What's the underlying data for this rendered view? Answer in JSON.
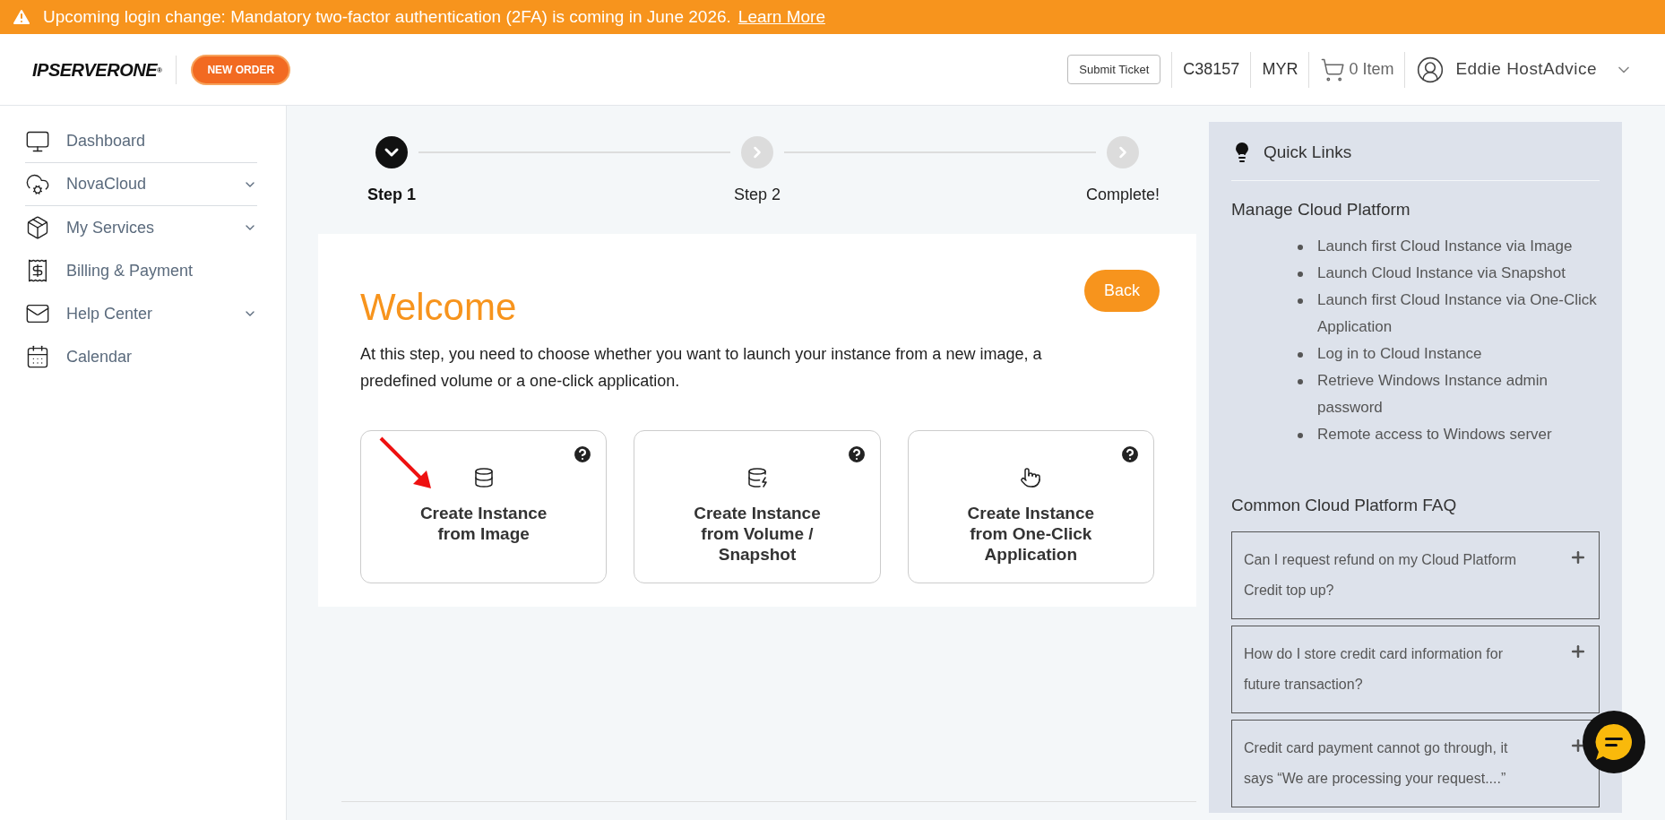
{
  "banner": {
    "text": "Upcoming login change: Mandatory two-factor authentication (2FA) is coming in June 2026.",
    "link": "Learn More"
  },
  "header": {
    "logo": "IPSERVERONE",
    "logo_mark": "®",
    "new_order": "NEW ORDER",
    "submit_ticket": "Submit Ticket",
    "account": "C38157",
    "currency": "MYR",
    "cart": "0 Item",
    "user": "Eddie HostAdvice"
  },
  "sidebar": {
    "items": [
      {
        "label": "Dashboard",
        "kind": "dashboard",
        "expandable": false
      },
      {
        "label": "NovaCloud",
        "kind": "cloud",
        "expandable": true
      },
      {
        "label": "My Services",
        "kind": "box",
        "expandable": true
      },
      {
        "label": "Billing & Payment",
        "kind": "billing",
        "expandable": false
      },
      {
        "label": "Help Center",
        "kind": "mail",
        "expandable": true
      },
      {
        "label": "Calendar",
        "kind": "calendar",
        "expandable": false
      }
    ]
  },
  "steps": [
    {
      "label": "Step 1",
      "selected": true
    },
    {
      "label": "Step 2",
      "selected": false
    },
    {
      "label": "Complete!",
      "selected": false
    }
  ],
  "welcome": {
    "title": "Welcome",
    "back": "Back",
    "description": "At this step, you need to choose whether you want to launch your instance from a new image, a predefined volume or a one-click application.",
    "options": [
      {
        "label": "Create Instance from Image",
        "kind": "image",
        "highlighted": true
      },
      {
        "label": "Create Instance from Volume / Snapshot",
        "kind": "volume",
        "highlighted": false
      },
      {
        "label": "Create Instance from One-Click Application",
        "kind": "app",
        "highlighted": false
      }
    ]
  },
  "quick_links": {
    "title": "Quick Links",
    "section": "Manage Cloud Platform",
    "links": [
      "Launch first Cloud Instance via Image",
      "Launch Cloud Instance via Snapshot",
      "Launch first Cloud Instance via One-Click Application",
      "Log in to Cloud Instance",
      "Retrieve Windows Instance admin password",
      "Remote access to Windows server"
    ],
    "faq_title": "Common Cloud Platform FAQ",
    "faq": [
      {
        "question": "Can I request refund on my Cloud Platform Credit top up?",
        "expanded": false
      },
      {
        "question": "How do I store credit card information for future transaction?",
        "expanded": false
      },
      {
        "question": "Credit card payment cannot go through, it says “We are processing your request....”",
        "expanded": false
      }
    ]
  }
}
